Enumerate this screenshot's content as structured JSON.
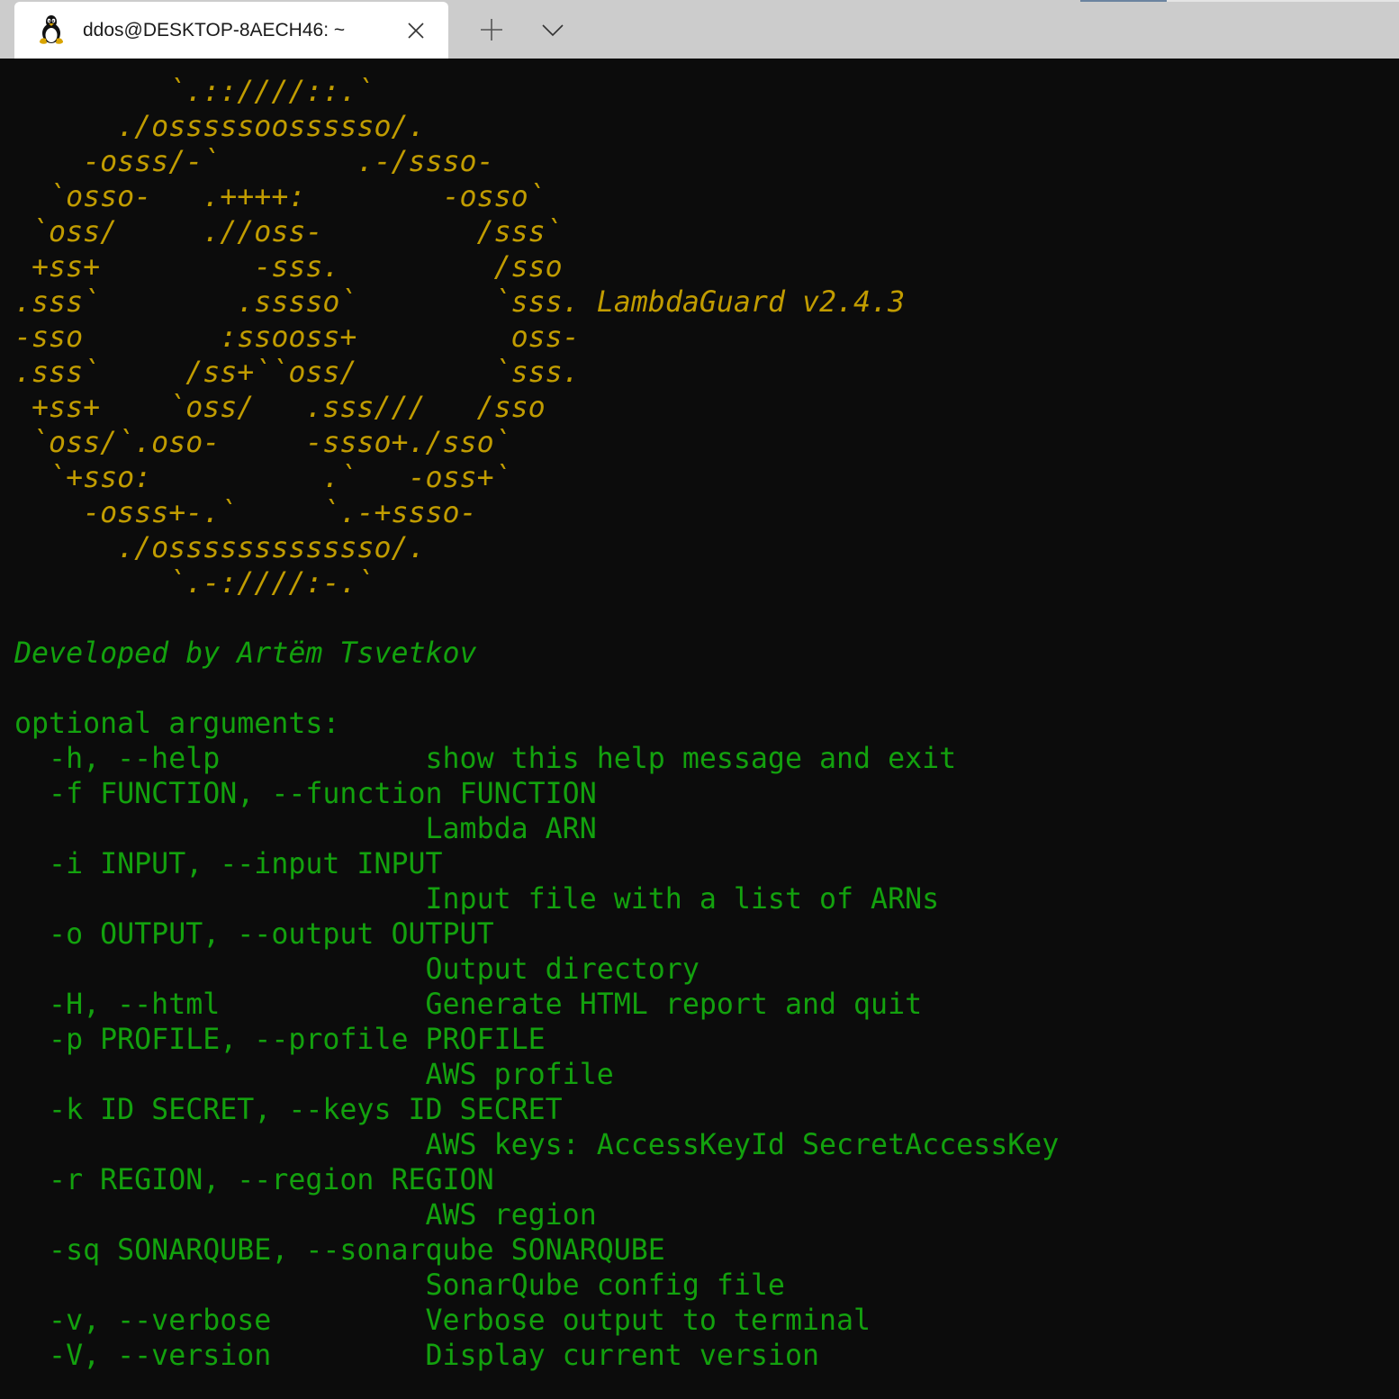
{
  "window": {
    "tab": {
      "icon": "linux-penguin-icon",
      "title": "ddos@DESKTOP-8AECH46: ~",
      "close_icon": "close-icon"
    },
    "new_tab_icon": "plus-icon",
    "dropdown_icon": "chevron-down-icon"
  },
  "terminal": {
    "colors": {
      "background": "#0c0c0c",
      "banner": "#c19c00",
      "text": "#13a10e"
    },
    "banner": {
      "art": [
        "         `.::////::.`",
        "      ./osssssoossssso/.",
        "    -osss/-`        .-/ssso-",
        "  `osso-   .++++:        -osso`",
        " `oss/     .//oss-         /sss`",
        " +ss+         -sss.         /sso",
        ".sss`        .sssso`        `sss.",
        "-sso        :ssooss+         oss-",
        ".sss`     /ss+``oss/        `sss.",
        " +ss+    `oss/   .sss///   /sso",
        " `oss/`.oso-     -ssso+./sso`",
        "  `+sso:          .`   -oss+`",
        "    -osss+-.`     `.-+ssso-",
        "      ./osssssssssssso/.",
        "         `.-:////:-.`"
      ],
      "title": "LambdaGuard v2.4.3"
    },
    "credit": "Developed by Artëm Tsvetkov",
    "help_header": "optional arguments:",
    "help_lines": [
      "  -h, --help            show this help message and exit",
      "  -f FUNCTION, --function FUNCTION",
      "                        Lambda ARN",
      "  -i INPUT, --input INPUT",
      "                        Input file with a list of ARNs",
      "  -o OUTPUT, --output OUTPUT",
      "                        Output directory",
      "  -H, --html            Generate HTML report and quit",
      "  -p PROFILE, --profile PROFILE",
      "                        AWS profile",
      "  -k ID SECRET, --keys ID SECRET",
      "                        AWS keys: AccessKeyId SecretAccessKey",
      "  -r REGION, --region REGION",
      "                        AWS region",
      "  -sq SONARQUBE, --sonarqube SONARQUBE",
      "                        SonarQube config file",
      "  -v, --verbose         Verbose output to terminal",
      "  -V, --version         Display current version"
    ]
  }
}
